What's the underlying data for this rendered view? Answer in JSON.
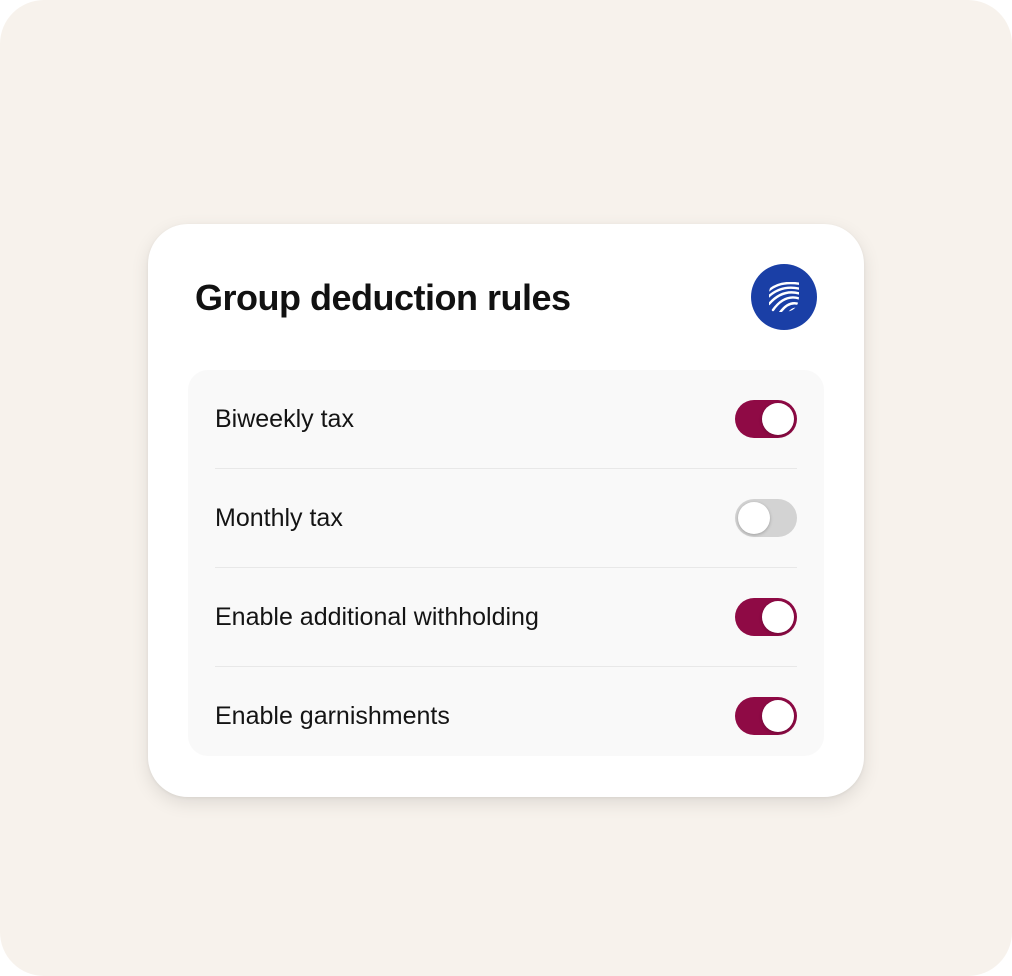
{
  "card": {
    "title": "Group deduction rules",
    "brand_icon": "striped-arcs-logo-icon",
    "brand_color": "#1a3fa6"
  },
  "colors": {
    "background": "#f7f2ec",
    "toggle_on": "#8f0a45",
    "toggle_off": "#d3d3d3"
  },
  "rules": [
    {
      "label": "Biweekly tax",
      "enabled": true
    },
    {
      "label": "Monthly tax",
      "enabled": false
    },
    {
      "label": "Enable additional withholding",
      "enabled": true
    },
    {
      "label": "Enable garnishments",
      "enabled": true
    }
  ]
}
